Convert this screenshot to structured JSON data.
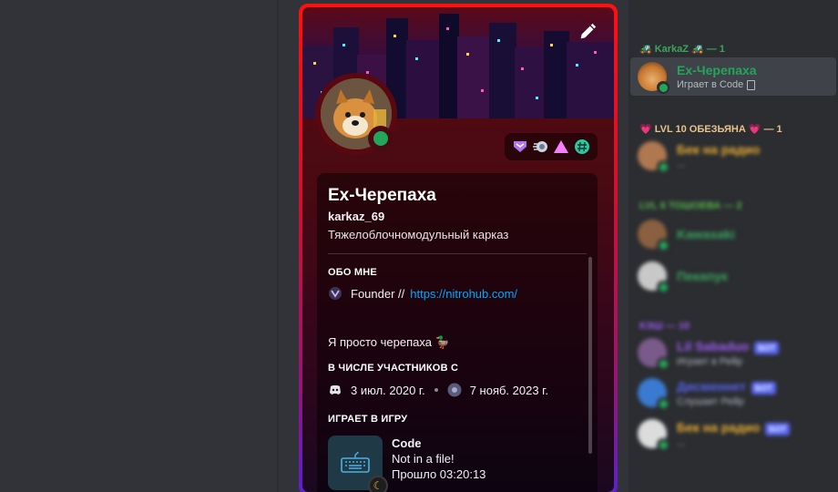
{
  "profile": {
    "display_name": "Ex-Черепаха",
    "username": "karkaz_69",
    "bio": "Тяжелоблочномодульный карказ",
    "about_title": "ОБО МНЕ",
    "about_line_label": "Founder //",
    "about_line_link": "https://nitrohub.com/",
    "about_text": "Я просто черепаха 🦆",
    "member_since_title": "В ЧИСЛЕ УЧАСТНИКОВ С",
    "discord_since": "3 июл. 2020 г.",
    "server_since": "7 нояб. 2023 г.",
    "playing_title": "ИГРАЕТ В ИГРУ",
    "game_name": "Code",
    "game_details": "Not in a file!",
    "game_elapsed": "Прошло 03:20:13",
    "badges": [
      "nitro-icon",
      "boost-icon",
      "triangle-icon",
      "hashtag-icon"
    ]
  },
  "members": {
    "group1": {
      "name": "KarkaZ",
      "count": "— 1",
      "color": "#3ba55d"
    },
    "active_member": {
      "name": "Ex-Черепаха",
      "status": "Играет в Code",
      "name_color": "#23a55a"
    },
    "group2": {
      "name": "LVL 10 ОБЕЗЬЯНА",
      "count": "— 1",
      "color": "#e8c28a"
    },
    "group2_members": [
      {
        "name": "Бек на радио",
        "status": "...",
        "color": "#f0b232"
      }
    ],
    "group3": {
      "name": "LVL 6 ТОШОЕВА",
      "count": "— 2",
      "color": "#57b84b"
    },
    "group3_members": [
      {
        "name": "Kawasaki",
        "status": "",
        "color": "#3ba55d"
      },
      {
        "name": "Пекапук",
        "status": "",
        "color": "#3ba55d"
      }
    ],
    "group4": {
      "name": "КЭШ — 10",
      "color": "#a25cf5"
    },
    "group4_members": [
      {
        "name": "Lil Sabaduo",
        "status": "Играет в Рейр",
        "color": "#a25cf5",
        "tag": "БОТ"
      },
      {
        "name": "Дисменнет",
        "status": "Слушает Рейр",
        "color": "#5865f2",
        "tag": "БОТ"
      },
      {
        "name": "Бек на радио",
        "status": "...",
        "color": "#f0b232",
        "tag": "БОТ"
      }
    ]
  },
  "colors": {
    "accent": "#ff1010",
    "online": "#23a55a",
    "link": "#00a8fc"
  }
}
